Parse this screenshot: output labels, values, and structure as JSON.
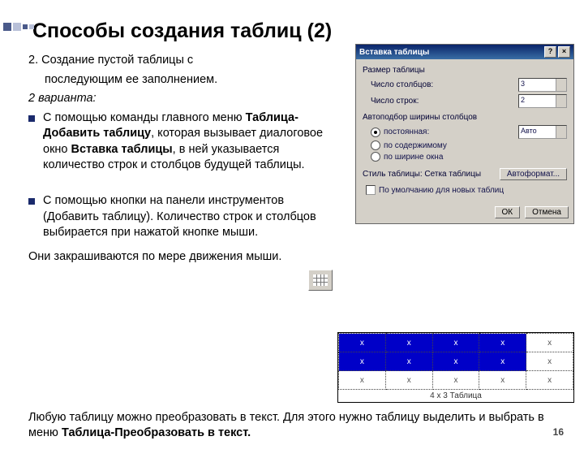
{
  "deco": true,
  "title": "Способы создания таблиц (2)",
  "intro_num": "2. Создание пустой таблицы с",
  "intro_rest": "последующим ее заполнением.",
  "variants": "2 варианта:",
  "bullet1": "С помощью команды главного меню ",
  "bullet1_bold1": "Таблица-Добавить таблицу",
  "bullet1_mid": ", которая вызывает диалоговое окно ",
  "bullet1_bold2": "Вставка таблицы",
  "bullet1_end": ", в ней указывается количество строк и столбцов будущей таблицы.",
  "bullet2": "С помощью кнопки на панели инструментов (Добавить таблицу). Количество строк и столбцов выбирается при нажатой кнопке мыши.",
  "bullet2_tail": "Они закрашиваются по мере движения мыши.",
  "footer_a": "Любую таблицу можно преобразовать в текст. Для этого нужно таблицу выделить и выбрать в меню  ",
  "footer_b": "Таблица-Преобразовать в текст.",
  "page": "16",
  "dialog": {
    "title": "Вставка таблицы",
    "size_label": "Размер таблицы",
    "cols_label": "Число столбцов:",
    "cols_value": "3",
    "rows_label": "Число строк:",
    "rows_value": "2",
    "autofit_label": "Автоподбор ширины столбцов",
    "r1": "постоянная:",
    "r1_value": "Авто",
    "r2": "по содержимому",
    "r3": "по ширине окна",
    "style_label": "Стиль таблицы: Сетка таблицы",
    "autoformat": "Автоформат...",
    "remember": "По умолчанию для новых таблиц",
    "ok": "ОК",
    "cancel": "Отмена"
  },
  "grid_caption": "4 x 3 Таблица",
  "cells": [
    "x",
    "x",
    "x",
    "x",
    "x",
    "x",
    "x",
    "x",
    "x",
    "x",
    "x",
    "x"
  ]
}
